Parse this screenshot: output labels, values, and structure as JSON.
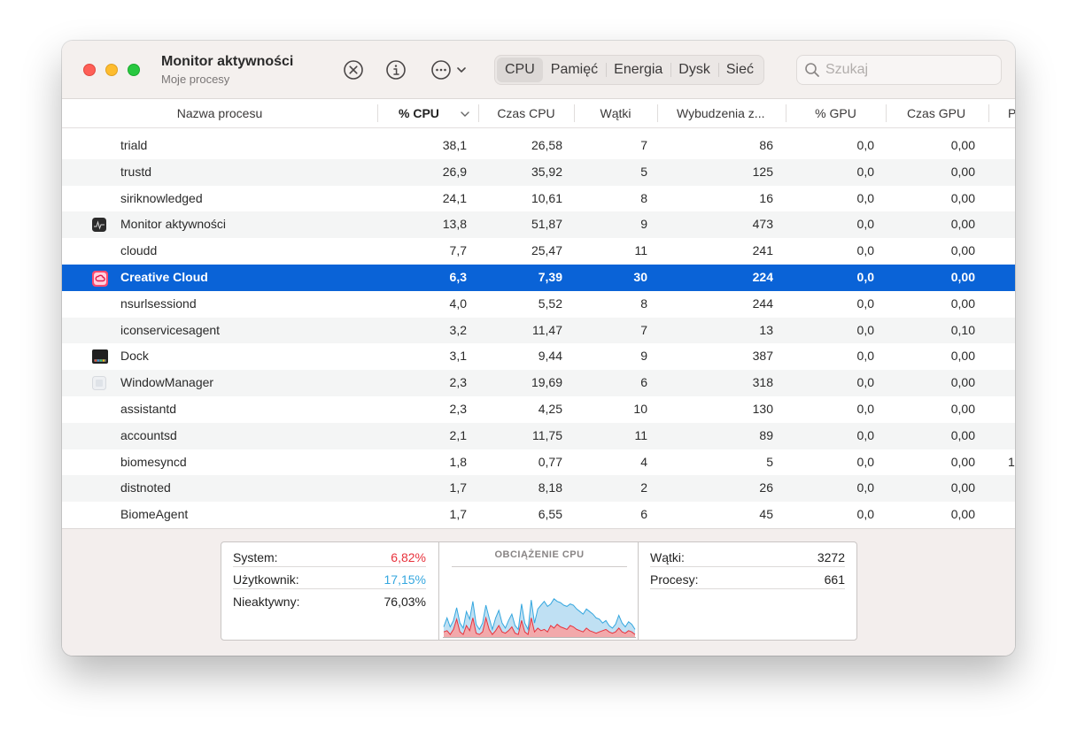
{
  "window": {
    "title": "Monitor aktywności",
    "subtitle": "Moje procesy"
  },
  "toolbar": {
    "stop_icon": "x-circle-icon",
    "info_icon": "info-icon",
    "more_icon": "ellipsis-circle-icon",
    "tabs": [
      {
        "label": "CPU",
        "active": true
      },
      {
        "label": "Pamięć",
        "active": false
      },
      {
        "label": "Energia",
        "active": false
      },
      {
        "label": "Dysk",
        "active": false
      },
      {
        "label": "Sieć",
        "active": false
      }
    ],
    "search_placeholder": "Szukaj"
  },
  "table": {
    "columns": [
      "Nazwa procesu",
      "% CPU",
      "Czas CPU",
      "Wątki",
      "Wybudzenia z...",
      "% GPU",
      "Czas GPU",
      "P"
    ],
    "sorted_column": "% CPU",
    "rows": [
      {
        "name": "triald",
        "cpu": "38,1",
        "cpu_time": "26,58",
        "threads": "7",
        "wakeups": "86",
        "gpu": "0,0",
        "gpu_time": "0,00",
        "extra": "",
        "icon": "none"
      },
      {
        "name": "trustd",
        "cpu": "26,9",
        "cpu_time": "35,92",
        "threads": "5",
        "wakeups": "125",
        "gpu": "0,0",
        "gpu_time": "0,00",
        "extra": "",
        "icon": "none"
      },
      {
        "name": "siriknowledged",
        "cpu": "24,1",
        "cpu_time": "10,61",
        "threads": "8",
        "wakeups": "16",
        "gpu": "0,0",
        "gpu_time": "0,00",
        "extra": "",
        "icon": "none"
      },
      {
        "name": "Monitor aktywności",
        "cpu": "13,8",
        "cpu_time": "51,87",
        "threads": "9",
        "wakeups": "473",
        "gpu": "0,0",
        "gpu_time": "0,00",
        "extra": "",
        "icon": "activity-monitor-icon"
      },
      {
        "name": "cloudd",
        "cpu": "7,7",
        "cpu_time": "25,47",
        "threads": "11",
        "wakeups": "241",
        "gpu": "0,0",
        "gpu_time": "0,00",
        "extra": "",
        "icon": "none"
      },
      {
        "name": "Creative Cloud",
        "cpu": "6,3",
        "cpu_time": "7,39",
        "threads": "30",
        "wakeups": "224",
        "gpu": "0,0",
        "gpu_time": "0,00",
        "extra": "",
        "icon": "creative-cloud-icon",
        "selected": true
      },
      {
        "name": "nsurlsessiond",
        "cpu": "4,0",
        "cpu_time": "5,52",
        "threads": "8",
        "wakeups": "244",
        "gpu": "0,0",
        "gpu_time": "0,00",
        "extra": "",
        "icon": "none"
      },
      {
        "name": "iconservicesagent",
        "cpu": "3,2",
        "cpu_time": "11,47",
        "threads": "7",
        "wakeups": "13",
        "gpu": "0,0",
        "gpu_time": "0,10",
        "extra": "",
        "icon": "none"
      },
      {
        "name": "Dock",
        "cpu": "3,1",
        "cpu_time": "9,44",
        "threads": "9",
        "wakeups": "387",
        "gpu": "0,0",
        "gpu_time": "0,00",
        "extra": "",
        "icon": "dock-icon"
      },
      {
        "name": "WindowManager",
        "cpu": "2,3",
        "cpu_time": "19,69",
        "threads": "6",
        "wakeups": "318",
        "gpu": "0,0",
        "gpu_time": "0,00",
        "extra": "",
        "icon": "window-manager-icon"
      },
      {
        "name": "assistantd",
        "cpu": "2,3",
        "cpu_time": "4,25",
        "threads": "10",
        "wakeups": "130",
        "gpu": "0,0",
        "gpu_time": "0,00",
        "extra": "",
        "icon": "none"
      },
      {
        "name": "accountsd",
        "cpu": "2,1",
        "cpu_time": "11,75",
        "threads": "11",
        "wakeups": "89",
        "gpu": "0,0",
        "gpu_time": "0,00",
        "extra": "",
        "icon": "none"
      },
      {
        "name": "biomesyncd",
        "cpu": "1,8",
        "cpu_time": "0,77",
        "threads": "4",
        "wakeups": "5",
        "gpu": "0,0",
        "gpu_time": "0,00",
        "extra": "1",
        "icon": "none"
      },
      {
        "name": "distnoted",
        "cpu": "1,7",
        "cpu_time": "8,18",
        "threads": "2",
        "wakeups": "26",
        "gpu": "0,0",
        "gpu_time": "0,00",
        "extra": "",
        "icon": "none"
      },
      {
        "name": "BiomeAgent",
        "cpu": "1,7",
        "cpu_time": "6,55",
        "threads": "6",
        "wakeups": "45",
        "gpu": "0,0",
        "gpu_time": "0,00",
        "extra": "",
        "icon": "none"
      }
    ]
  },
  "summary": {
    "system_label": "System:",
    "system_value": "6,82%",
    "user_label": "Użytkownik:",
    "user_value": "17,15%",
    "idle_label": "Nieaktywny:",
    "idle_value": "76,03%",
    "graph_title": "OBCIĄŻENIE CPU",
    "threads_label": "Wątki:",
    "threads_value": "3272",
    "processes_label": "Procesy:",
    "processes_value": "661",
    "colors": {
      "system": "#e8323c",
      "user": "#35a7df",
      "system_fill": "#f2a9ab",
      "user_fill": "#bfe0f3"
    }
  },
  "cpu_load_graph": {
    "system_pct": [
      8,
      10,
      4,
      12,
      28,
      8,
      4,
      18,
      10,
      30,
      6,
      4,
      8,
      30,
      12,
      4,
      10,
      18,
      8,
      6,
      10,
      16,
      6,
      4,
      26,
      8,
      4,
      30,
      8,
      14,
      10,
      12,
      8,
      18,
      14,
      20,
      16,
      14,
      12,
      18,
      16,
      12,
      10,
      8,
      14,
      10,
      8,
      6,
      8,
      10,
      12,
      8,
      6,
      8,
      14,
      8,
      6,
      10,
      8,
      4
    ],
    "user_pct": [
      16,
      30,
      16,
      26,
      46,
      22,
      14,
      40,
      28,
      56,
      20,
      12,
      22,
      50,
      30,
      12,
      30,
      42,
      22,
      14,
      26,
      36,
      18,
      12,
      52,
      22,
      12,
      58,
      22,
      44,
      50,
      56,
      48,
      52,
      60,
      56,
      54,
      50,
      48,
      52,
      50,
      44,
      40,
      36,
      44,
      40,
      36,
      30,
      28,
      22,
      26,
      18,
      14,
      20,
      34,
      22,
      16,
      24,
      20,
      12
    ]
  }
}
